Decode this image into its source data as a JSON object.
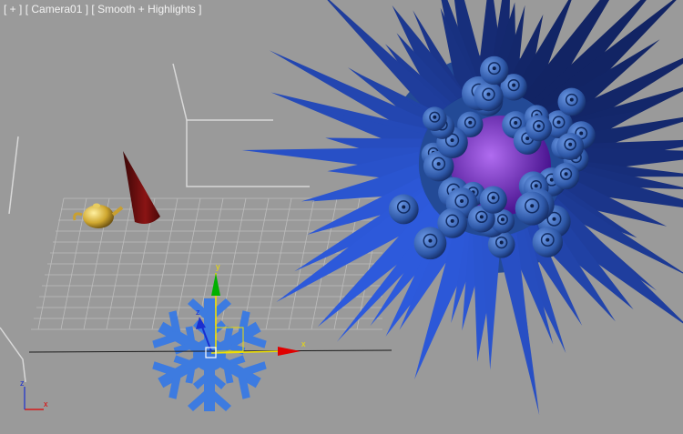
{
  "viewport": {
    "label_plus": "[ + ]",
    "label_camera": "[ Camera01 ]",
    "label_shading": "[ Smooth + Highlights ]"
  },
  "gizmo": {
    "axis_x": "x",
    "axis_y": "y",
    "axis_z": "z"
  },
  "axis_tripod": {
    "x": "x",
    "z": "z"
  },
  "colors": {
    "background": "#9a9a9a",
    "grid": "#b8b8b8",
    "spike_blue": "#2f5fb0",
    "teapot_blue": "#3566b8",
    "core_purple": "#7a2fd0",
    "cone_red": "#6a0f0f",
    "teapot_gold": "#d4b340",
    "snowflake": "#3d7be0",
    "axis_x": "#e00000",
    "axis_y": "#00b000",
    "axis_z": "#1a2fd0",
    "gizmo_yellow": "#f0e000"
  },
  "objects": [
    "teapot",
    "cone",
    "spiky-sphere",
    "snowflake"
  ]
}
